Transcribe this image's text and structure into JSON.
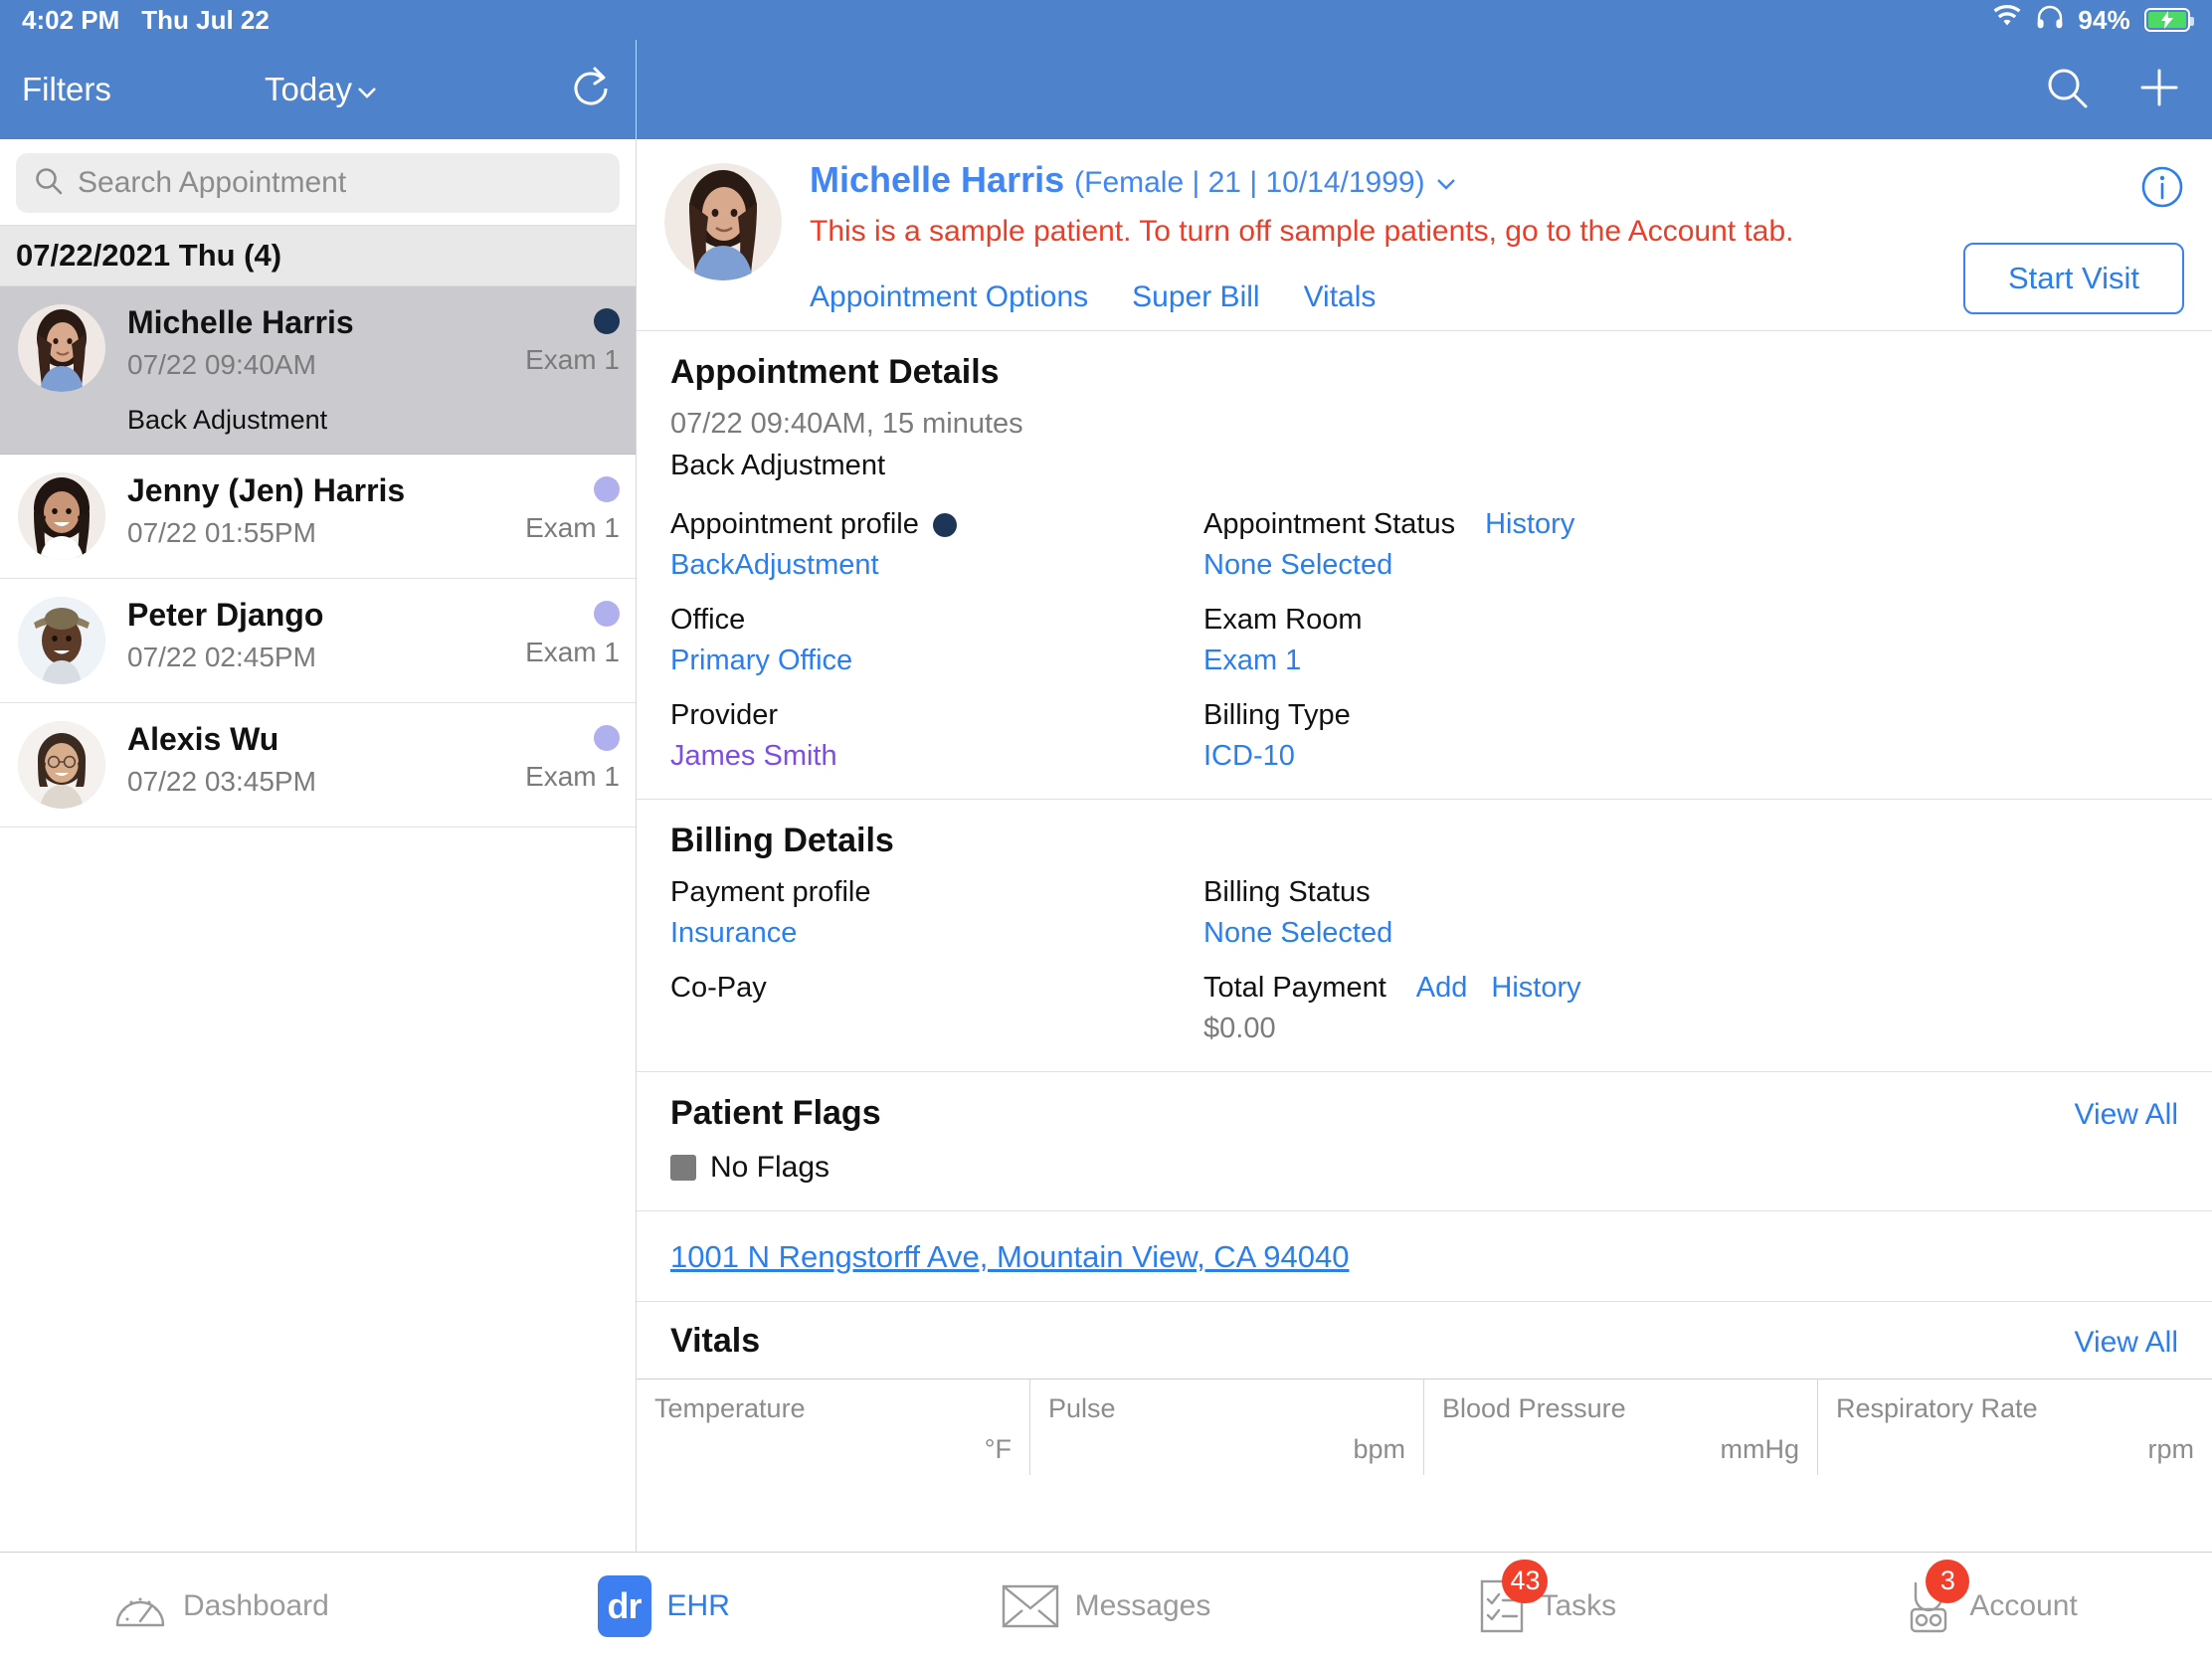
{
  "statusbar": {
    "time": "4:02 PM",
    "date": "Thu Jul 22",
    "battery_pct": "94%",
    "wifi_icon": "wifi-icon",
    "headphones_icon": "headphones-icon",
    "battery_icon": "battery-charging-icon"
  },
  "left_nav": {
    "filters_label": "Filters",
    "today_label": "Today",
    "refresh_icon": "refresh-icon"
  },
  "search": {
    "placeholder": "Search Appointment",
    "value": "",
    "icon": "search-icon"
  },
  "appointment_list": {
    "date_header": "07/22/2021 Thu (4)",
    "items": [
      {
        "name": "Michelle Harris",
        "time": "07/22 09:40AM",
        "room": "Exam 1",
        "reason": "Back Adjustment",
        "dot_color": "#1d3557",
        "selected": true
      },
      {
        "name": "Jenny (Jen) Harris",
        "time": "07/22 01:55PM",
        "room": "Exam 1",
        "reason": "",
        "dot_color": "#b0b0ee",
        "selected": false
      },
      {
        "name": "Peter Django",
        "time": "07/22 02:45PM",
        "room": "Exam 1",
        "reason": "",
        "dot_color": "#b0b0ee",
        "selected": false
      },
      {
        "name": "Alexis Wu",
        "time": "07/22 03:45PM",
        "room": "Exam 1",
        "reason": "",
        "dot_color": "#b0b0ee",
        "selected": false
      }
    ]
  },
  "right_nav": {
    "search_icon": "search-icon",
    "add_icon": "plus-icon"
  },
  "patient": {
    "name": "Michelle Harris",
    "demographics": "(Female | 21 | 10/14/1999)",
    "chevron_icon": "chevron-down-icon",
    "sample_notice": "This is a sample patient. To turn off sample patients, go to the Account tab.",
    "info_icon": "info-icon",
    "links": [
      {
        "label": "Appointment Options"
      },
      {
        "label": "Super Bill"
      },
      {
        "label": "Vitals"
      }
    ],
    "start_visit_label": "Start Visit"
  },
  "appointment_details": {
    "title": "Appointment Details",
    "datetime": "07/22 09:40AM, 15 minutes",
    "reason": "Back Adjustment",
    "fields": {
      "appointment_profile_label": "Appointment profile",
      "appointment_profile_value": "BackAdjustment",
      "appointment_status_label": "Appointment Status",
      "appointment_status_history": "History",
      "appointment_status_value": "None Selected",
      "office_label": "Office",
      "office_value": "Primary Office",
      "exam_room_label": "Exam Room",
      "exam_room_value": "Exam 1",
      "provider_label": "Provider",
      "provider_value": "James Smith",
      "billing_type_label": "Billing Type",
      "billing_type_value": "ICD-10"
    }
  },
  "billing_details": {
    "title": "Billing Details",
    "payment_profile_label": "Payment profile",
    "payment_profile_value": "Insurance",
    "billing_status_label": "Billing Status",
    "billing_status_value": "None Selected",
    "copay_label": "Co-Pay",
    "copay_value": "",
    "total_payment_label": "Total Payment",
    "total_payment_add": "Add",
    "total_payment_history": "History",
    "total_payment_value": "$0.00"
  },
  "patient_flags": {
    "title": "Patient Flags",
    "view_all": "View All",
    "flag_text": "No Flags"
  },
  "address": {
    "text": "1001 N Rengstorff Ave, Mountain View, CA 94040"
  },
  "vitals": {
    "title": "Vitals",
    "view_all": "View All",
    "columns": [
      {
        "name": "Temperature",
        "unit": "°F",
        "value": ""
      },
      {
        "name": "Pulse",
        "unit": "bpm",
        "value": ""
      },
      {
        "name": "Blood Pressure",
        "unit": "mmHg",
        "value": ""
      },
      {
        "name": "Respiratory Rate",
        "unit": "rpm",
        "value": ""
      }
    ]
  },
  "tabbar": {
    "tabs": [
      {
        "label": "Dashboard",
        "icon": "gauge-icon",
        "badge": "",
        "active": false
      },
      {
        "label": "EHR",
        "icon": "dr-logo-icon",
        "badge": "",
        "active": true
      },
      {
        "label": "Messages",
        "icon": "envelope-icon",
        "badge": "",
        "active": false
      },
      {
        "label": "Tasks",
        "icon": "checklist-icon",
        "badge": "43",
        "active": false
      },
      {
        "label": "Account",
        "icon": "stethoscope-icon",
        "badge": "3",
        "active": false
      }
    ]
  },
  "colors": {
    "header_blue": "#4e82ca",
    "link_blue": "#2a7ef0",
    "name_blue": "#4285f4",
    "alert_red": "#f03c26",
    "badge_red": "#f0402c",
    "provider_purple": "#7d4ee0",
    "dark_dot": "#1d3557",
    "light_dot": "#b0b0ee"
  }
}
